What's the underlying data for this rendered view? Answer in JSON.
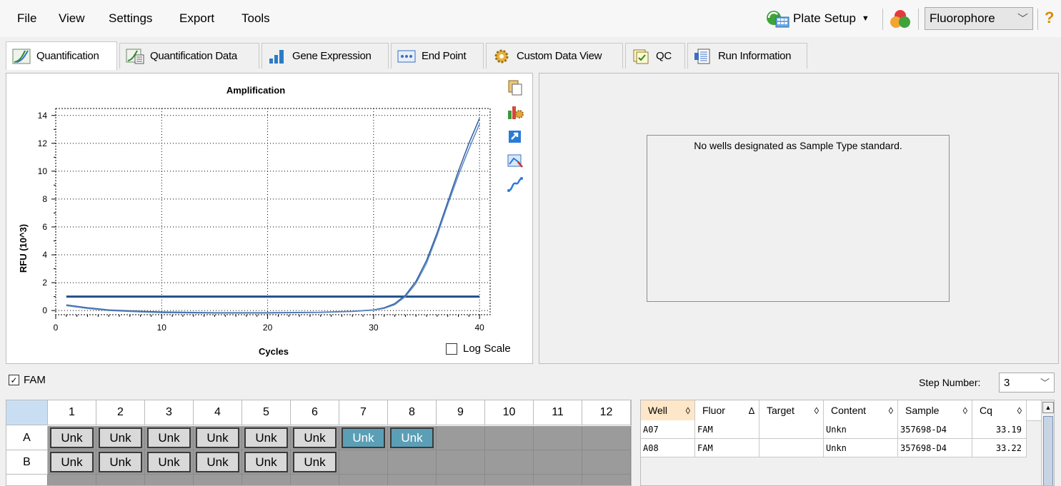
{
  "menu": {
    "items": [
      "File",
      "View",
      "Settings",
      "Export",
      "Tools"
    ]
  },
  "toolbar": {
    "plate_setup_label": "Plate Setup",
    "fluorophore_value": "Fluorophore",
    "help_glyph": "?"
  },
  "tabs": [
    {
      "label": "Quantification",
      "active": true
    },
    {
      "label": "Quantification Data"
    },
    {
      "label": "Gene Expression"
    },
    {
      "label": "End Point"
    },
    {
      "label": "Custom Data View"
    },
    {
      "label": "QC"
    },
    {
      "label": "Run Information"
    }
  ],
  "chart_data": {
    "type": "line",
    "title": "Amplification",
    "xlabel": "Cycles",
    "ylabel": "RFU (10^3)",
    "xlim": [
      0,
      41
    ],
    "ylim": [
      -0.3,
      14.5
    ],
    "xticks": [
      0,
      10,
      20,
      30,
      40
    ],
    "yticks": [
      0,
      2,
      4,
      6,
      8,
      10,
      12,
      14
    ],
    "grid": "dotted",
    "threshold": 1.0,
    "series": [
      {
        "color": "#2e5f9e",
        "x": [
          1,
          3,
          5,
          8,
          10,
          15,
          20,
          25,
          28,
          30,
          31,
          32,
          33,
          34,
          35,
          36,
          37,
          38,
          39,
          40
        ],
        "y": [
          0.4,
          0.2,
          0.05,
          -0.05,
          -0.1,
          -0.15,
          -0.15,
          -0.12,
          -0.05,
          0.05,
          0.2,
          0.5,
          1.1,
          2.1,
          3.6,
          5.6,
          7.8,
          10.0,
          12.0,
          13.8
        ]
      },
      {
        "color": "#5b87c4",
        "x": [
          1,
          3,
          5,
          8,
          10,
          15,
          20,
          25,
          28,
          30,
          31,
          32,
          33,
          34,
          35,
          36,
          37,
          38,
          39,
          40
        ],
        "y": [
          0.35,
          0.15,
          0.0,
          -0.1,
          -0.15,
          -0.18,
          -0.18,
          -0.14,
          -0.07,
          0.03,
          0.15,
          0.42,
          1.0,
          1.95,
          3.4,
          5.4,
          7.6,
          9.7,
          11.6,
          13.4
        ]
      }
    ]
  },
  "log_scale_label": "Log Scale",
  "std_message": "No wells designated as Sample Type standard.",
  "fam_label": "FAM",
  "step_number": {
    "label": "Step Number:",
    "value": "3"
  },
  "plate": {
    "columns": [
      "1",
      "2",
      "3",
      "4",
      "5",
      "6",
      "7",
      "8",
      "9",
      "10",
      "11",
      "12"
    ],
    "rows": [
      {
        "label": "A",
        "wells": [
          "Unk",
          "Unk",
          "Unk",
          "Unk",
          "Unk",
          "Unk",
          "Unk",
          "Unk",
          "",
          "",
          "",
          ""
        ],
        "selected": [
          6,
          7
        ]
      },
      {
        "label": "B",
        "wells": [
          "Unk",
          "Unk",
          "Unk",
          "Unk",
          "Unk",
          "Unk",
          "",
          "",
          "",
          "",
          "",
          ""
        ],
        "selected": []
      }
    ]
  },
  "data_table": {
    "headers": [
      "Well",
      "Fluor",
      "Target",
      "Content",
      "Sample",
      "Cq"
    ],
    "rows": [
      [
        "A07",
        "FAM",
        "",
        "Unkn",
        "357698-D4",
        "33.19"
      ],
      [
        "A08",
        "FAM",
        "",
        "Unkn",
        "357698-D4",
        "33.22"
      ]
    ]
  }
}
